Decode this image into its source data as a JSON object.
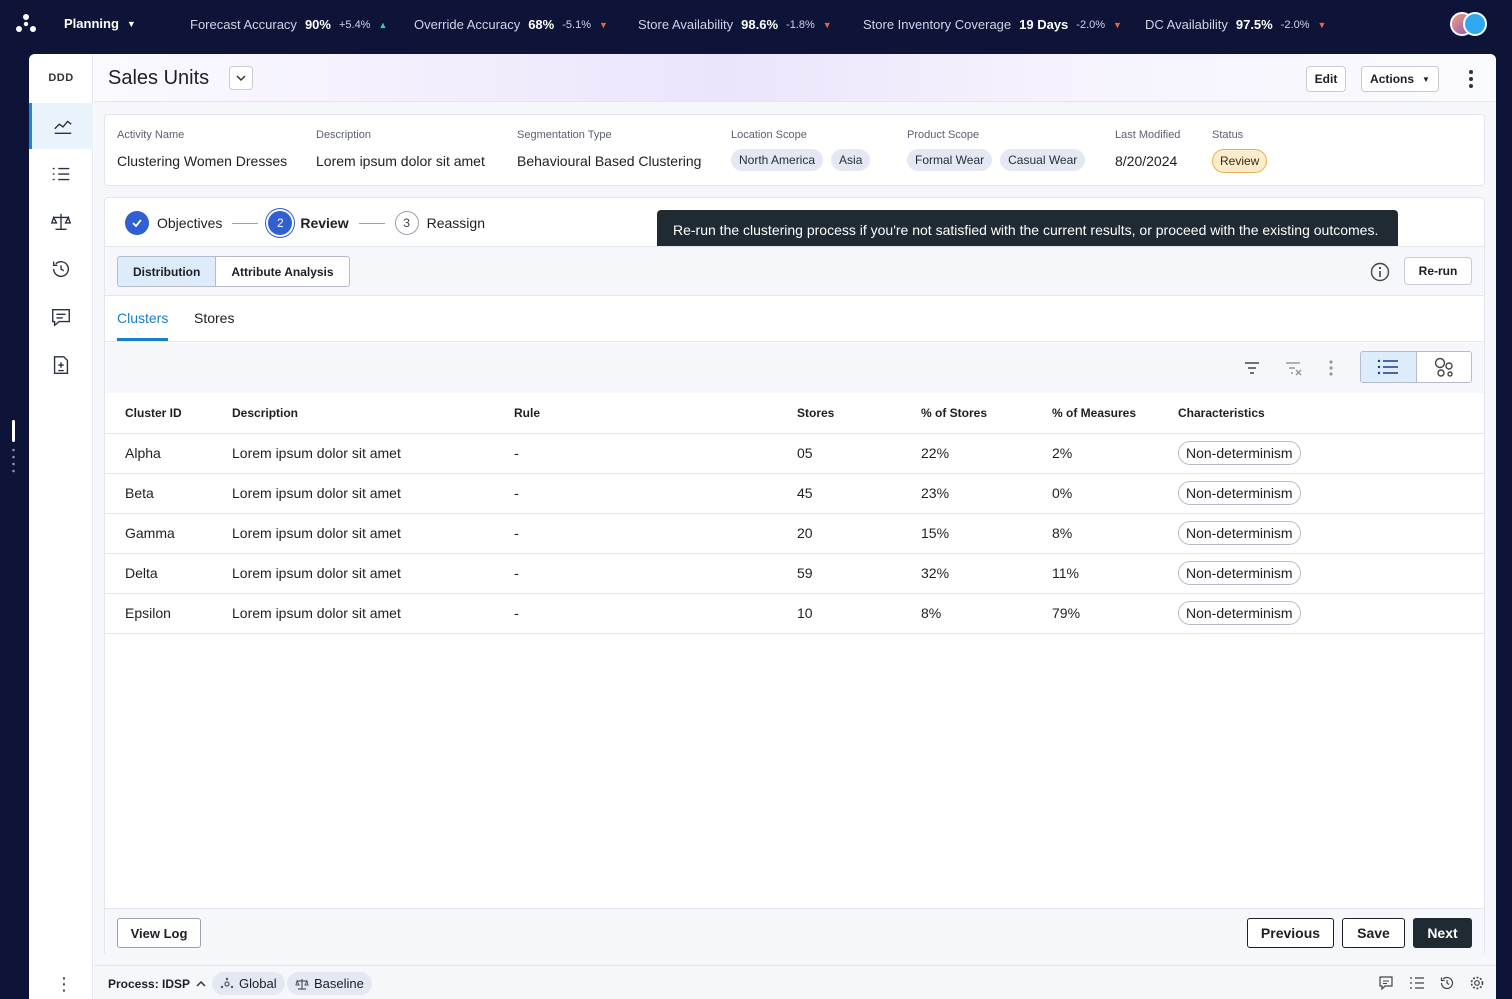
{
  "topbar": {
    "app_menu": "Planning",
    "kpis": [
      {
        "label": "Forecast Accuracy",
        "value": "90%",
        "delta": "+5.4%",
        "direction": "up"
      },
      {
        "label": "Override Accuracy",
        "value": "68%",
        "delta": "-5.1%",
        "direction": "down"
      },
      {
        "label": "Store Availability",
        "value": "98.6%",
        "delta": "-1.8%",
        "direction": "down"
      },
      {
        "label": "Store Inventory Coverage",
        "value": "19 Days",
        "delta": "-2.0%",
        "direction": "down"
      },
      {
        "label": "DC Availability",
        "value": "97.5%",
        "delta": "-2.0%",
        "direction": "down"
      }
    ]
  },
  "leftnav": {
    "brand": "DDD",
    "items": [
      "trend-chart-icon",
      "checklist-icon",
      "balance-scale-icon",
      "history-icon",
      "comments-icon",
      "document-calc-icon"
    ]
  },
  "header": {
    "title": "Sales Units",
    "edit_label": "Edit",
    "actions_label": "Actions"
  },
  "info": {
    "activity_name_label": "Activity Name",
    "activity_name": "Clustering Women Dresses",
    "description_label": "Description",
    "description": "Lorem ipsum dolor sit amet",
    "segmentation_label": "Segmentation Type",
    "segmentation": "Behavioural Based Clustering",
    "location_label": "Location Scope",
    "locations": [
      "North America",
      "Asia"
    ],
    "product_label": "Product Scope",
    "products": [
      "Formal Wear",
      "Casual Wear"
    ],
    "modified_label": "Last Modified",
    "modified": "8/20/2024",
    "status_label": "Status",
    "status": "Review"
  },
  "stepper": {
    "steps": [
      {
        "num": "",
        "label": "Objectives"
      },
      {
        "num": "2",
        "label": "Review"
      },
      {
        "num": "3",
        "label": "Reassign"
      }
    ]
  },
  "tooltip": "Re-run the clustering process if you're not satisfied with the current results, or proceed with the existing outcomes.",
  "subbar": {
    "seg_distribution": "Distribution",
    "seg_attribute": "Attribute Analysis",
    "rerun_label": "Re-run"
  },
  "tabs": {
    "clusters": "Clusters",
    "stores": "Stores"
  },
  "table": {
    "headers": [
      "Cluster ID",
      "Description",
      "Rule",
      "Stores",
      "% of Stores",
      "% of Measures",
      "Characteristics"
    ],
    "rows": [
      [
        "Alpha",
        "Lorem ipsum dolor sit amet",
        "-",
        "05",
        "22%",
        "2%",
        "Non-determinism"
      ],
      [
        "Beta",
        "Lorem ipsum dolor sit amet",
        "-",
        "45",
        "23%",
        "0%",
        "Non-determinism"
      ],
      [
        "Gamma",
        "Lorem ipsum dolor sit amet",
        "-",
        "20",
        "15%",
        "8%",
        "Non-determinism"
      ],
      [
        "Delta",
        "Lorem ipsum dolor sit amet",
        "-",
        "59",
        "32%",
        "11%",
        "Non-determinism"
      ],
      [
        "Epsilon",
        "Lorem ipsum dolor sit amet",
        "-",
        "10",
        "8%",
        "79%",
        "Non-determinism"
      ]
    ]
  },
  "footer": {
    "view_log": "View Log",
    "previous": "Previous",
    "save": "Save",
    "next": "Next"
  },
  "bottombar": {
    "process": "Process: IDSP",
    "global": "Global",
    "baseline": "Baseline"
  },
  "colors": {
    "accent": "#1a7ec4",
    "step": "#2f5fd0",
    "status_bg": "#fdeccb",
    "topbar_bg": "#0d1438"
  }
}
